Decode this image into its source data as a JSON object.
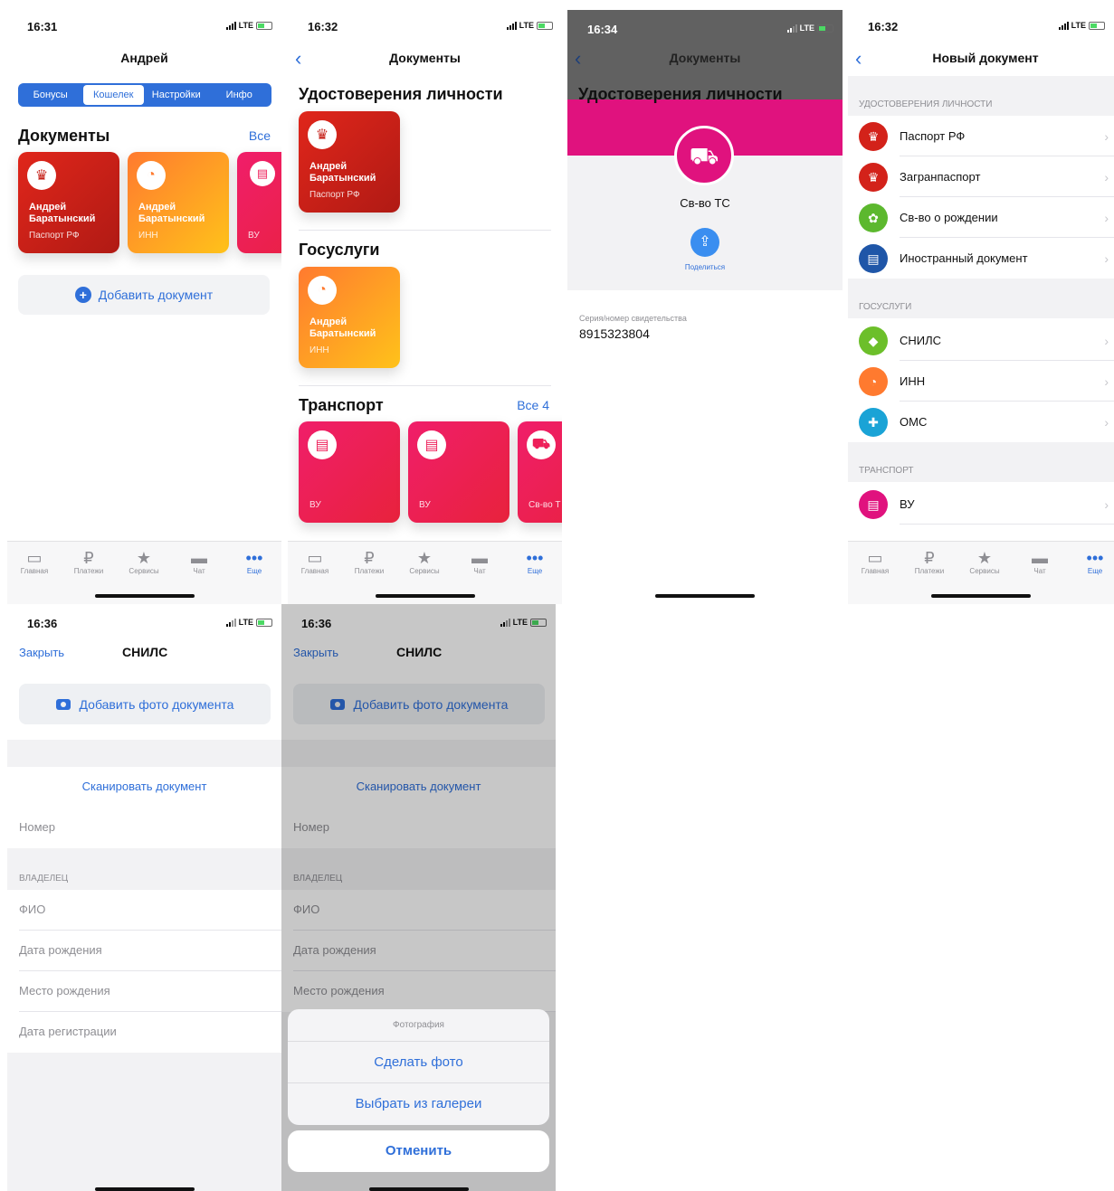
{
  "colors": {
    "accent": "#2f6fd9",
    "red_card": "#d3221a",
    "orange_card": "#ff9a22",
    "pink_card": "#ee1f5a",
    "magenta": "#e0127e"
  },
  "screen1": {
    "time": "16:31",
    "network": "LTE",
    "title": "Андрей",
    "segments": [
      "Бонусы",
      "Кошелек",
      "Настройки",
      "Инфо"
    ],
    "selected_segment": "Кошелек",
    "section_title": "Документы",
    "all_link": "Все",
    "cards": [
      {
        "name": "Андрей Баратынский",
        "sub": "Паспорт РФ",
        "icon": "eagle-emblem-icon"
      },
      {
        "name": "Андрей Баратынский",
        "sub": "ИНН",
        "icon": "pie-icon"
      },
      {
        "name": "",
        "sub": "ВУ",
        "icon": "license-icon"
      }
    ],
    "add_button": "Добавить документ"
  },
  "tabs": [
    {
      "label": "Главная",
      "icon": "card-icon"
    },
    {
      "label": "Платежи",
      "icon": "ruble-icon"
    },
    {
      "label": "Сервисы",
      "icon": "star-icon"
    },
    {
      "label": "Чат",
      "icon": "chat-icon"
    },
    {
      "label": "Еще",
      "icon": "more-icon"
    }
  ],
  "screen2": {
    "time": "16:32",
    "network": "LTE",
    "title": "Документы",
    "sections": [
      {
        "title": "Удостоверения личности",
        "link": ""
      },
      {
        "title": "Госуслуги",
        "link": ""
      },
      {
        "title": "Транспорт",
        "link": "Все 4"
      }
    ],
    "id_card": {
      "name": "Андрей Баратынский",
      "sub": "Паспорт РФ"
    },
    "gos_card": {
      "name": "Андрей Баратынский",
      "sub": "ИНН"
    },
    "transport_cards": [
      {
        "sub": "ВУ"
      },
      {
        "sub": "ВУ"
      },
      {
        "sub": "Св-во Т"
      }
    ]
  },
  "screen3": {
    "time": "16:34",
    "network": "LTE",
    "title": "Документы",
    "section_title": "Удостоверения личности",
    "doc_title": "Св-во ТС",
    "share_label": "Поделиться",
    "field_label": "Серия/номер свидетельства",
    "field_value": "8915323804"
  },
  "screen4": {
    "time": "16:32",
    "network": "LTE",
    "title": "Новый документ",
    "groups": [
      {
        "header": "УДОСТОВЕРЕНИЯ ЛИЧНОСТИ",
        "items": [
          {
            "label": "Паспорт РФ",
            "icon": "eagle-emblem-icon",
            "color": "#d3221a"
          },
          {
            "label": "Загранпаспорт",
            "icon": "eagle-emblem-icon",
            "color": "#d3221a"
          },
          {
            "label": "Св-во о рождении",
            "icon": "stroller-icon",
            "color": "#5cb82e"
          },
          {
            "label": "Иностранный документ",
            "icon": "document-icon",
            "color": "#1f56a8"
          }
        ]
      },
      {
        "header": "ГОСУСЛУГИ",
        "items": [
          {
            "label": "СНИЛС",
            "icon": "shield-icon",
            "color": "#6cbf2a"
          },
          {
            "label": "ИНН",
            "icon": "pie-icon",
            "color": "#ff7a2f"
          },
          {
            "label": "ОМС",
            "icon": "medical-cross-icon",
            "color": "#1aa3d6"
          }
        ]
      },
      {
        "header": "ТРАНСПОРТ",
        "items": [
          {
            "label": "ВУ",
            "icon": "license-icon",
            "color": "#e0127e"
          }
        ]
      }
    ]
  },
  "form": {
    "time": "16:36",
    "network": "LTE",
    "close": "Закрыть",
    "title": "СНИЛС",
    "add_photo": "Добавить фото документа",
    "scan": "Сканировать документ",
    "number": "Номер",
    "owner_header": "ВЛАДЕЛЕЦ",
    "fields": [
      "ФИО",
      "Дата рождения",
      "Место рождения",
      "Дата регистрации"
    ]
  },
  "action_sheet": {
    "title": "Фотография",
    "options": [
      "Сделать фото",
      "Выбрать из галереи"
    ],
    "cancel": "Отменить"
  }
}
